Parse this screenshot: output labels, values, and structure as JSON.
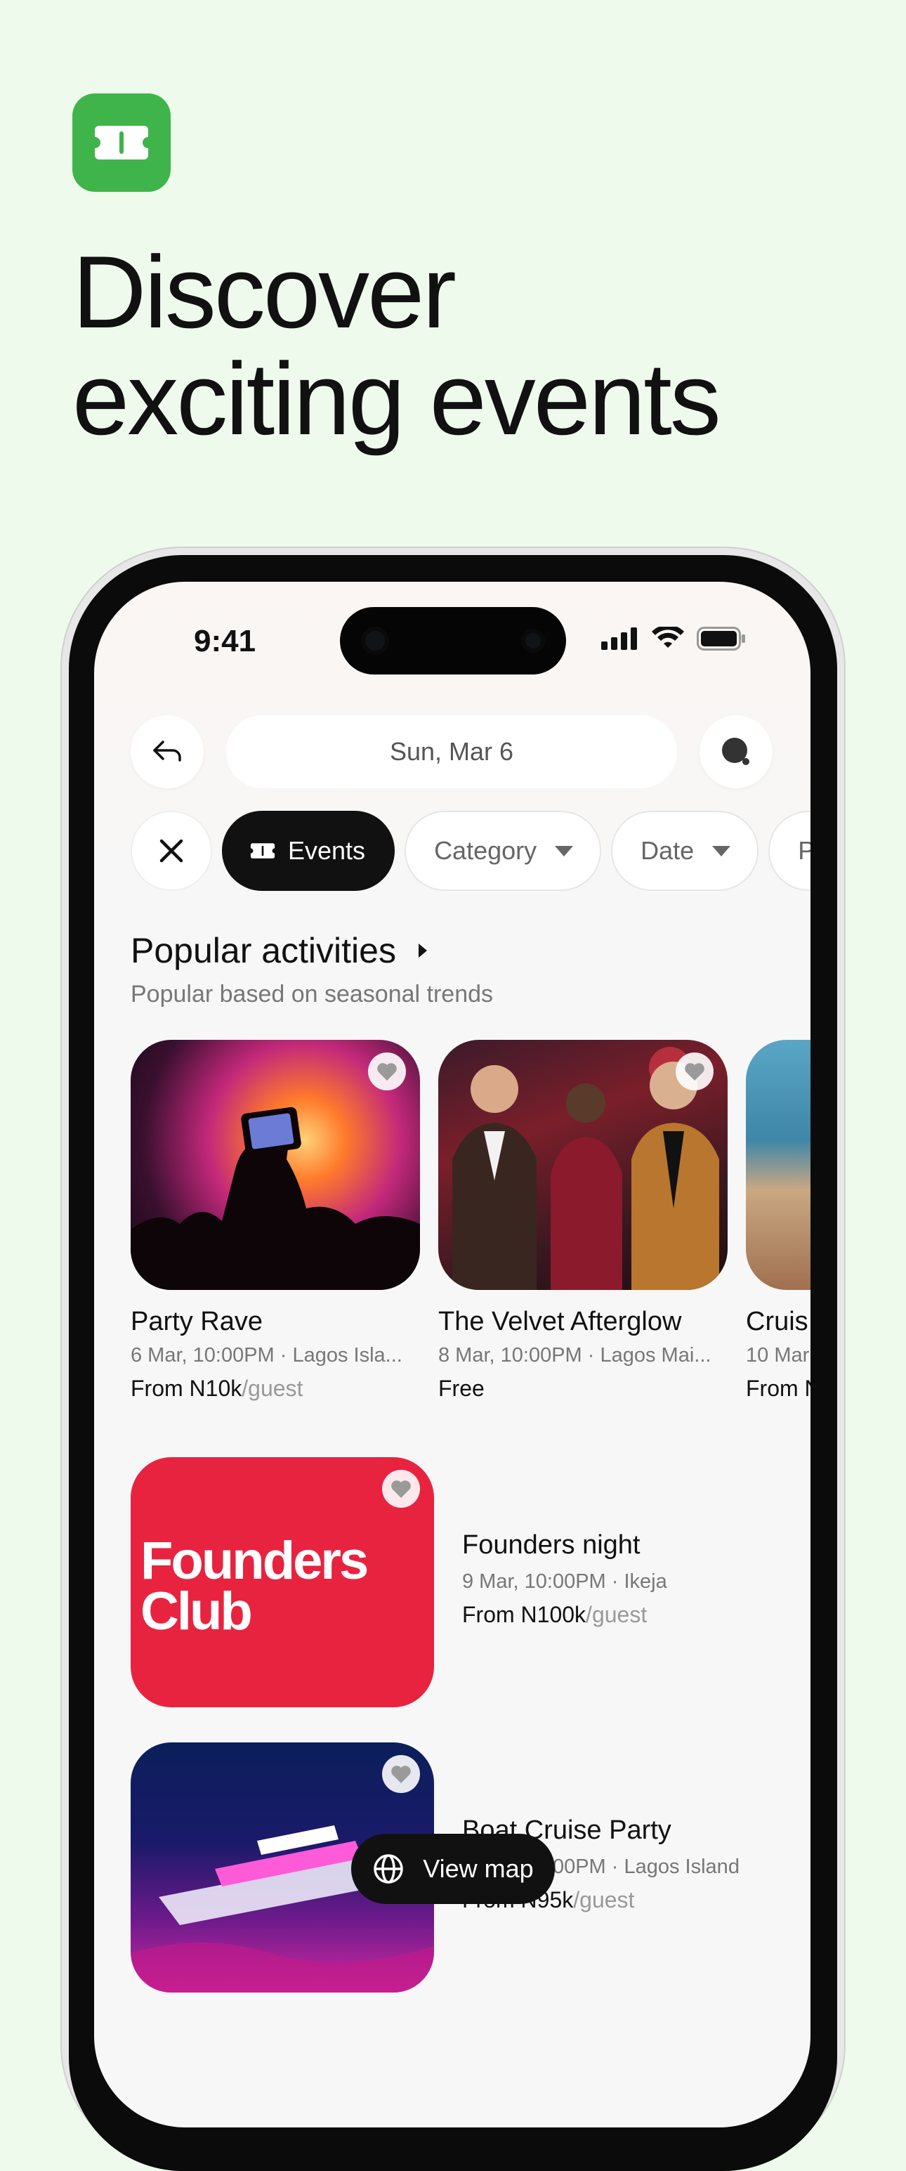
{
  "hero": {
    "headline_line1": "Discover",
    "headline_line2": "exciting events",
    "brand_color": "#3fb44a"
  },
  "status_bar": {
    "time": "9:41"
  },
  "header": {
    "date": "Sun, Mar 6"
  },
  "filters": {
    "chips": [
      {
        "label": "Events",
        "active": true,
        "icon": "ticket-icon"
      },
      {
        "label": "Category",
        "active": false
      },
      {
        "label": "Date",
        "active": false
      },
      {
        "label": "P",
        "active": false
      }
    ]
  },
  "section": {
    "title": "Popular activities",
    "subtitle": "Popular based on seasonal trends"
  },
  "cards": [
    {
      "title": "Party Rave",
      "meta": "6 Mar, 10:00PM · Lagos Isla...",
      "price": "From N10k",
      "unit": "/guest"
    },
    {
      "title": "The Velvet Afterglow",
      "meta": "8 Mar, 10:00PM · Lagos Mai...",
      "price": "Free",
      "unit": ""
    },
    {
      "title": "Cruis",
      "meta": "10 Mar",
      "price": "From N",
      "unit": ""
    }
  ],
  "list": [
    {
      "title": "Founders night",
      "meta": "9 Mar, 10:00PM · Ikeja",
      "price": "From N100k",
      "unit": "/guest",
      "image_text_line1": "Founders",
      "image_text_line2": "Club"
    },
    {
      "title": "Boat Cruise Party",
      "meta": "6 Mar, 10:00PM · Lagos Island",
      "price": "From N95k",
      "unit": "/guest"
    }
  ],
  "map_button": {
    "label": "View map"
  }
}
